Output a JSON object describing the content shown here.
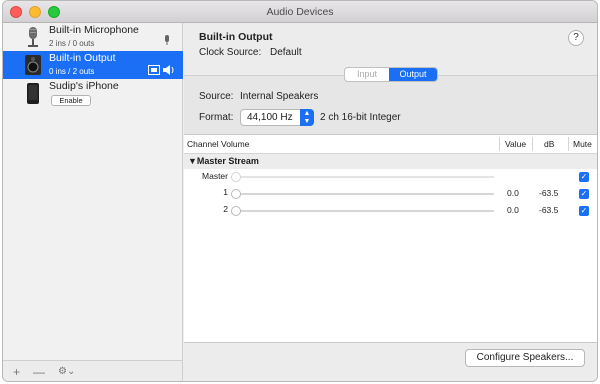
{
  "window": {
    "title": "Audio Devices"
  },
  "devices": [
    {
      "name": "Built-in Microphone",
      "sub": "2 ins / 0 outs",
      "icon": "microphone-icon"
    },
    {
      "name": "Built-in Output",
      "sub": "0 ins / 2 outs",
      "icon": "speaker-icon",
      "selected": true
    },
    {
      "name": "Sudip's iPhone",
      "button": "Enable",
      "icon": "iphone-icon"
    }
  ],
  "sidebar_footer": {
    "add": "+",
    "remove": "—",
    "gear": "⚙︎⌄"
  },
  "detail": {
    "title": "Built-in Output",
    "clock_source_label": "Clock Source:",
    "clock_source_value": "Default",
    "help": "?",
    "tabs": {
      "input": "Input",
      "output": "Output",
      "selected": "Output"
    },
    "source_label": "Source:",
    "source_value": "Internal Speakers",
    "format_label": "Format:",
    "format_value": "44,100 Hz",
    "format_desc": "2 ch 16-bit Integer"
  },
  "table": {
    "headers": {
      "channel_volume": "Channel Volume",
      "value": "Value",
      "db": "dB",
      "mute": "Mute"
    },
    "group": "▼Master Stream",
    "rows": [
      {
        "label": "Master",
        "value": "",
        "db": "",
        "muted": true,
        "level": 0
      },
      {
        "label": "1",
        "value": "0.0",
        "db": "-63.5",
        "muted": true,
        "level": 0
      },
      {
        "label": "2",
        "value": "0.0",
        "db": "-63.5",
        "muted": true,
        "level": 0
      }
    ]
  },
  "configure_button": "Configure Speakers...",
  "colors": {
    "accent": "#1b6ff5"
  }
}
